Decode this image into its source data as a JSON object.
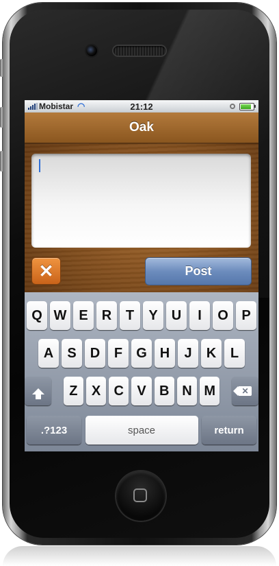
{
  "status_bar": {
    "carrier": "Mobistar",
    "time": "21:12",
    "battery_level": 0.85
  },
  "nav": {
    "title": "Oak"
  },
  "compose": {
    "text": "",
    "post_label": "Post",
    "cancel_symbol": "✕"
  },
  "keyboard": {
    "row1": [
      "Q",
      "W",
      "E",
      "R",
      "T",
      "Y",
      "U",
      "I",
      "O",
      "P"
    ],
    "row2": [
      "A",
      "S",
      "D",
      "F",
      "G",
      "H",
      "J",
      "K",
      "L"
    ],
    "row3": [
      "Z",
      "X",
      "C",
      "V",
      "B",
      "N",
      "M"
    ],
    "numbers_label": ".?123",
    "space_label": "space",
    "return_label": "return",
    "delete_symbol": "✕"
  },
  "colors": {
    "wood": "#7d4b1c",
    "post_button": "#6c8cbd",
    "cancel_button": "#e07a2a",
    "caret": "#2f6fd6"
  }
}
